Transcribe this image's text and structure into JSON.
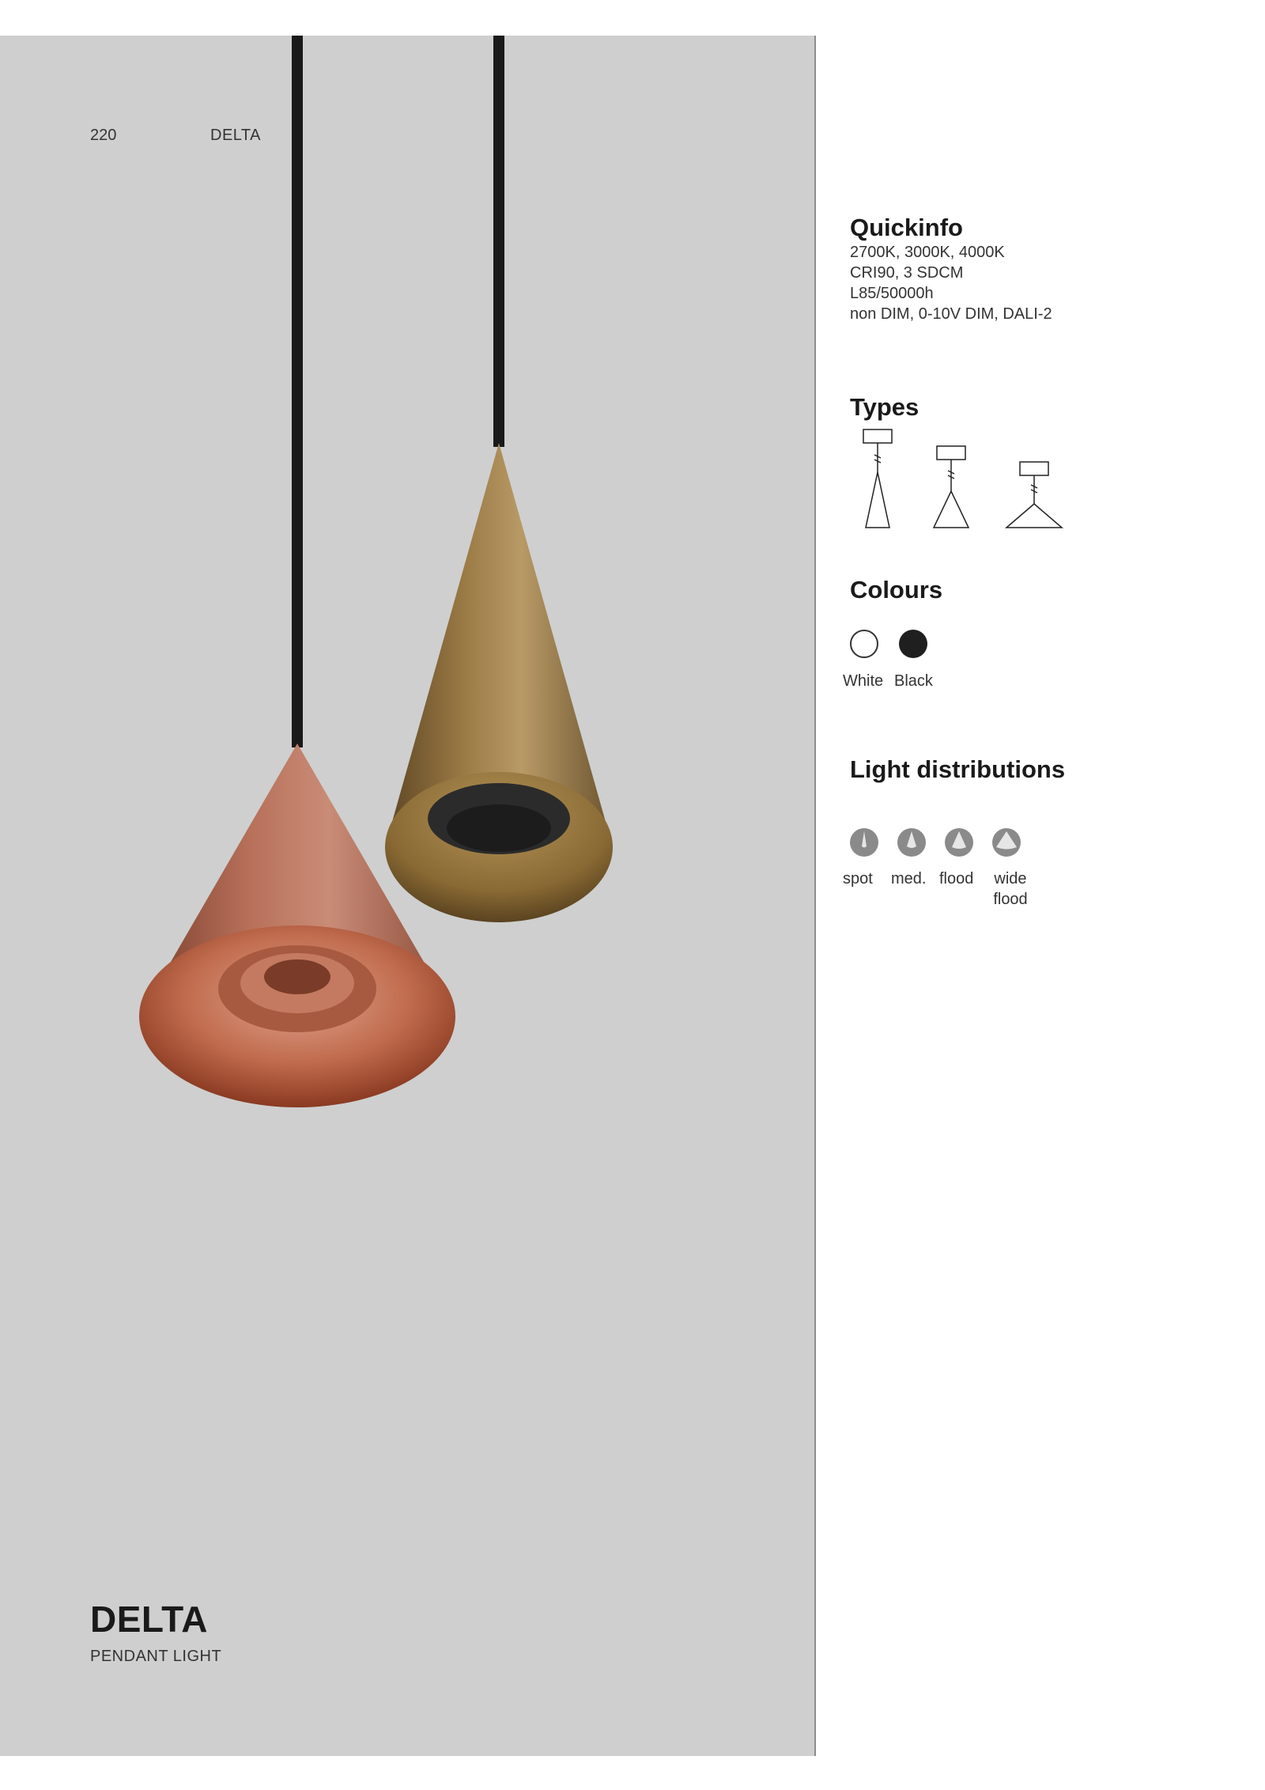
{
  "header": {
    "page_number": "220",
    "running_title": "DELTA"
  },
  "product": {
    "name": "DELTA",
    "subtitle": "PENDANT LIGHT"
  },
  "quickinfo": {
    "title": "Quickinfo",
    "lines": [
      "2700K,  3000K,  4000K",
      "CRI90, 3 SDCM",
      "L85/50000h",
      "non DIM, 0-10V DIM, DALI-2"
    ]
  },
  "types": {
    "title": "Types"
  },
  "colours": {
    "title": "Colours",
    "items": [
      {
        "label": "White",
        "color": "#ffffff"
      },
      {
        "label": "Black",
        "color": "#1f1f1f"
      }
    ]
  },
  "light_distributions": {
    "title": "Light distributions",
    "items": [
      {
        "label": "spot"
      },
      {
        "label": "med."
      },
      {
        "label": "flood"
      },
      {
        "label": "wide flood"
      }
    ]
  },
  "colors": {
    "panel_bg": "#cfcfcf",
    "copper": "#b56a52",
    "brass": "#9b7a45",
    "cable": "#1a1a1a"
  }
}
